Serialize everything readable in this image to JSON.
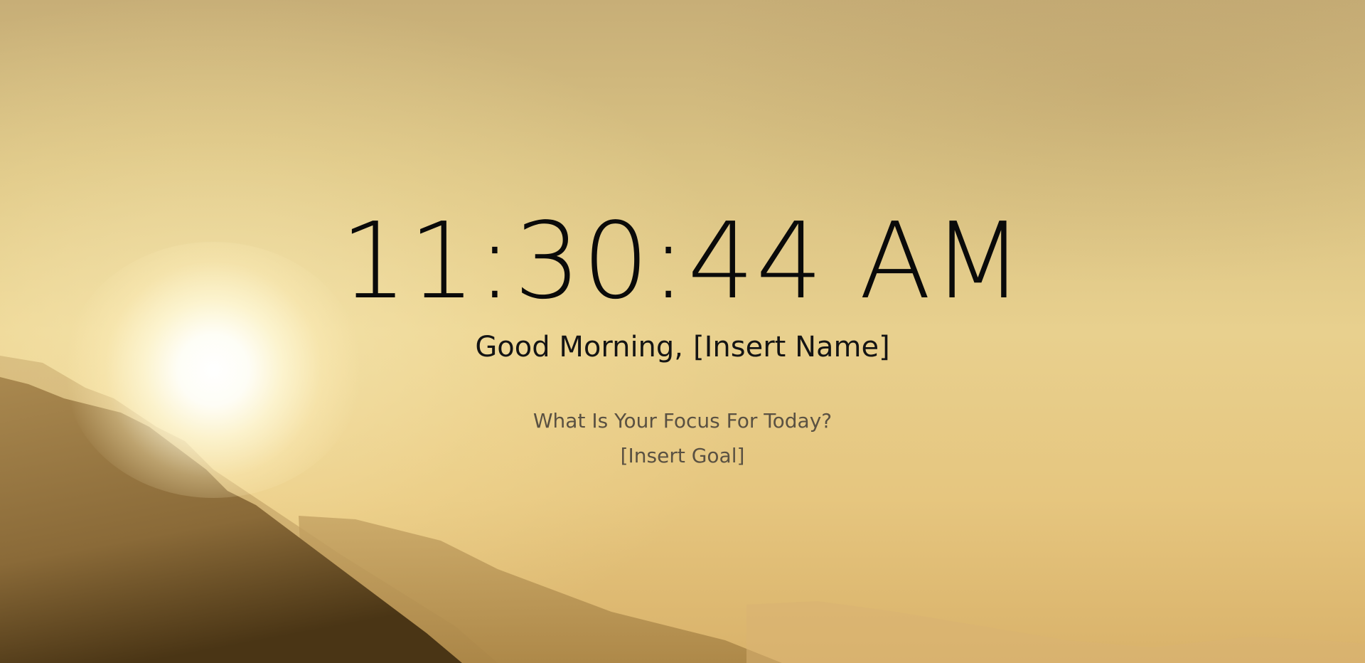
{
  "clock": {
    "time": "11:30:44 AM"
  },
  "greeting": {
    "salutation": "Good Morning,",
    "name": "[Insert Name]"
  },
  "focus": {
    "question": "What Is Your Focus For Today?",
    "goal": "[Insert Goal]"
  },
  "colors": {
    "text_primary": "#0a0a0a",
    "text_secondary": "#5a5142",
    "sky": "#d9c283",
    "sun": "#ffffff"
  }
}
